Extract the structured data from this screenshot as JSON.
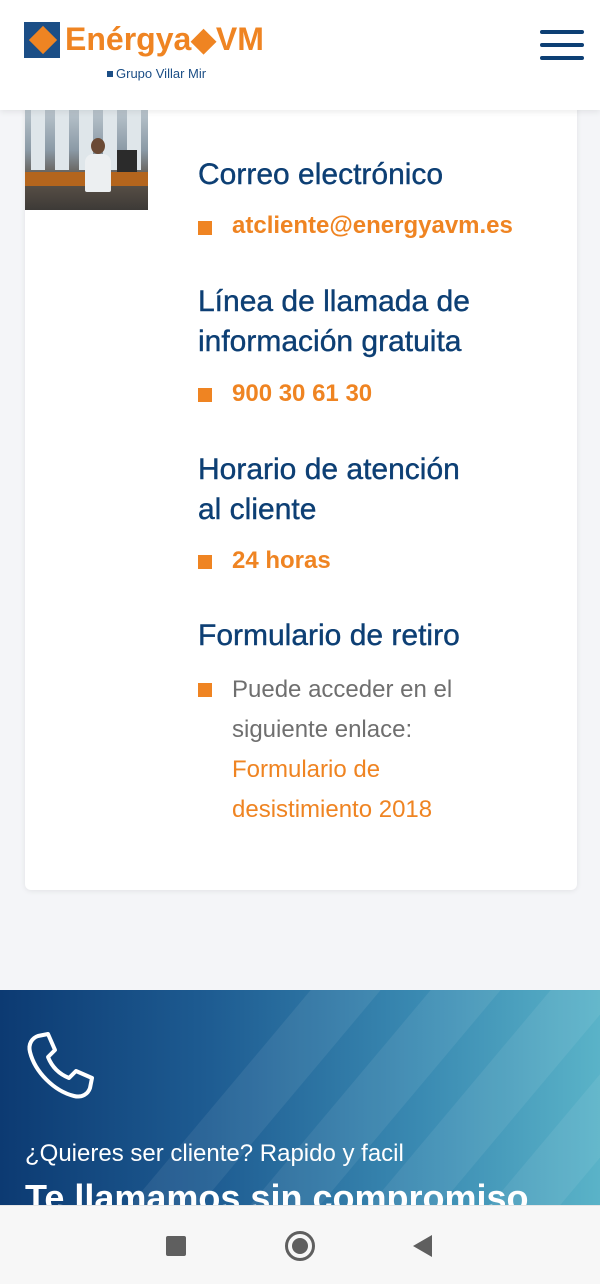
{
  "header": {
    "logo_text": "Enérgya◆VM",
    "logo_subtitle": "Grupo Villar Mir",
    "menu_icon": "hamburger-menu-icon"
  },
  "contact": {
    "photo_icon": "office-photo",
    "email": {
      "title": "Correo electrónico",
      "value": "atcliente@energyavm.es"
    },
    "phone": {
      "title_line1": "Línea de llamada de",
      "title_line2": "información gratuita",
      "value": "900 30 61 30"
    },
    "hours": {
      "title_line1": "Horario de atención",
      "title_line2": "al cliente",
      "value": "24 horas"
    },
    "withdrawal": {
      "title": "Formulario de retiro",
      "text_line1": "Puede acceder en el",
      "text_line2": "siguiente enlace:",
      "link_line1": "Formulario de",
      "link_line2": "desistimiento 2018"
    }
  },
  "banner": {
    "icon": "phone-icon",
    "subtitle": "¿Quieres ser cliente? Rapido y facil",
    "title": "Te llamamos sin compromiso"
  },
  "navbar": {
    "icons": [
      "recents-square-icon",
      "home-circle-icon",
      "back-triangle-icon"
    ]
  },
  "colors": {
    "brand_blue": "#0d3f74",
    "brand_orange": "#ef8422",
    "text_gray": "#6f6f6f"
  }
}
